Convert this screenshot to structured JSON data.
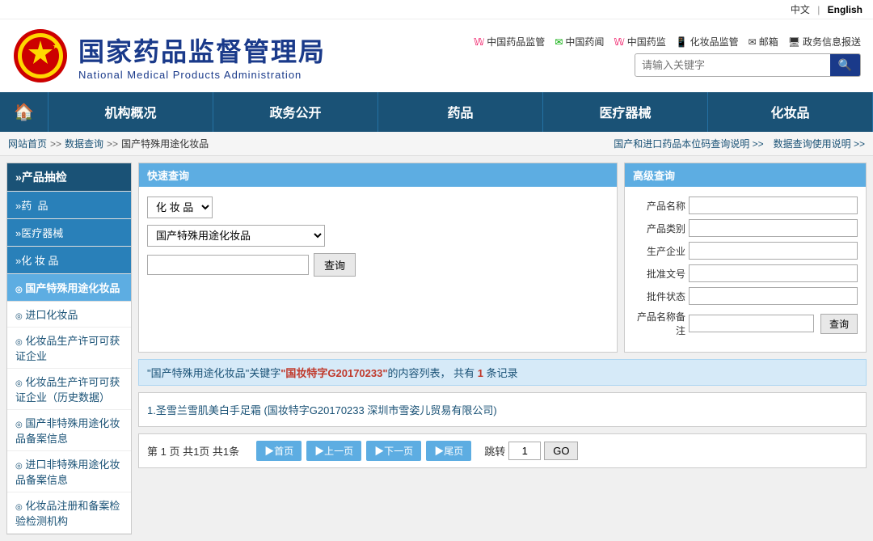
{
  "lang_bar": {
    "chinese": "中文",
    "separator": "|",
    "english": "English"
  },
  "header": {
    "logo_text_cn": "国家药品监督管理局",
    "logo_text_en": "National Medical Products Administration",
    "icon_links": [
      {
        "label": "中国药品监管",
        "icon": "weibo"
      },
      {
        "label": "中国药闻",
        "icon": "wechat"
      },
      {
        "label": "中国药监",
        "icon": "weibo2"
      },
      {
        "label": "化妆品监管",
        "icon": "phone"
      },
      {
        "label": "邮箱",
        "icon": "mail"
      },
      {
        "label": "政务信息报送",
        "icon": "screen"
      }
    ],
    "search_placeholder": "请输入关键字"
  },
  "main_nav": {
    "home_icon": "🏠",
    "items": [
      {
        "label": "机构概况"
      },
      {
        "label": "政务公开"
      },
      {
        "label": "药品"
      },
      {
        "label": "医疗器械"
      },
      {
        "label": "化妆品"
      }
    ]
  },
  "breadcrumb": {
    "links": [
      {
        "label": "网站首页"
      },
      {
        "sep": ">>"
      },
      {
        "label": "数据查询"
      },
      {
        "sep": ">>"
      },
      {
        "label": "国产特殊用途化妆品"
      }
    ],
    "right_links": [
      {
        "label": "国产和进口药品本位码查询说明 >>"
      },
      {
        "label": "数据查询使用说明 >>"
      }
    ]
  },
  "sidebar": {
    "items": [
      {
        "label": "»产品抽检",
        "type": "category"
      },
      {
        "label": "»药  品",
        "type": "sub"
      },
      {
        "label": "»医疗器械",
        "type": "sub"
      },
      {
        "label": "»化 妆 品",
        "type": "sub"
      },
      {
        "label": "国产特殊用途化妆品",
        "type": "active",
        "prefix": "◎"
      },
      {
        "label": "进口化妆品",
        "type": "plain",
        "prefix": "◎"
      },
      {
        "label": "化妆品生产许可可获证企业",
        "type": "plain",
        "prefix": "◎"
      },
      {
        "label": "化妆品生产许可可获证企业（历史数据）",
        "type": "plain",
        "prefix": "◎"
      },
      {
        "label": "国产非特殊用途化妆品备案信息",
        "type": "plain",
        "prefix": "◎"
      },
      {
        "label": "进口非特殊用途化妆品备案信息",
        "type": "plain",
        "prefix": "◎"
      },
      {
        "label": "化妆品注册和备案检验检测机构",
        "type": "plain",
        "prefix": "◎"
      }
    ]
  },
  "quick_query": {
    "panel_title": "快速查询",
    "select_options": [
      "化 妆 品"
    ],
    "select2_options": [
      "国产特殊用途化妆品"
    ],
    "btn_label": "查询",
    "input_placeholder": ""
  },
  "advanced_query": {
    "panel_title": "高级查询",
    "fields": [
      {
        "label": "产品名称",
        "id": "adv1"
      },
      {
        "label": "产品类别",
        "id": "adv2"
      },
      {
        "label": "生产企业",
        "id": "adv3"
      },
      {
        "label": "批准文号",
        "id": "adv4"
      },
      {
        "label": "批件状态",
        "id": "adv5"
      },
      {
        "label": "产品名称备注",
        "id": "adv6"
      }
    ],
    "btn_label": "查询"
  },
  "results": {
    "header_text": "\"国产特殊用途化妆品\"关键字",
    "keyword": "\"国妆特字G20170233\"",
    "suffix": "的内容列表，  共有",
    "count": "1",
    "count_unit": "条记录",
    "items": [
      {
        "text": "1.圣雪兰雪肌美白手足霜 (国妆特字G20170233 深圳市雪姿儿贸易有限公司)"
      }
    ]
  },
  "pagination": {
    "info": "第 1 页 共1页 共1条",
    "btns": [
      {
        "label": "▶首页"
      },
      {
        "label": "▶上一页"
      },
      {
        "label": "▶下一页"
      },
      {
        "label": "▶尾页"
      }
    ],
    "jump_label": "跳转",
    "jump_value": "1",
    "go_label": "GO"
  }
}
